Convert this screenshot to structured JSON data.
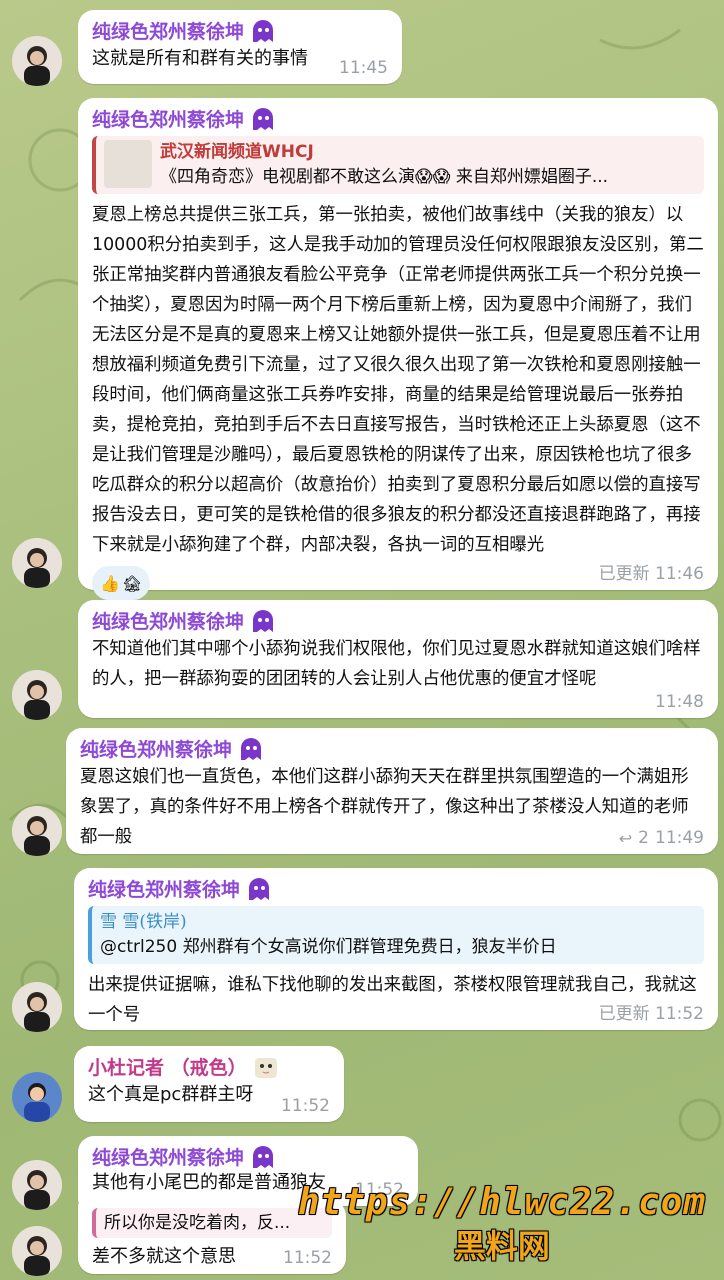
{
  "messages": [
    {
      "sender": "纯绿色郑州蔡徐坤",
      "text": "这就是所有和群有关的事情",
      "time": "11:45"
    },
    {
      "sender": "纯绿色郑州蔡徐坤",
      "reply": {
        "title": "武汉新闻频道WHCJ",
        "text": "《四角奇恋》电视剧都不敢这么演😱😱 来自郑州嫖娼圈子..."
      },
      "text": "夏恩上榜总共提供三张工兵，第一张拍卖，被他们故事线中（关我的狼友）以10000积分拍卖到手，这人是我手动加的管理员没任何权限跟狼友没区别，第二张正常抽奖群内普通狼友看脸公平竞争（正常老师提供两张工兵一个积分兑换一个抽奖），夏恩因为时隔一两个月下榜后重新上榜，因为夏恩中介闹掰了，我们无法区分是不是真的夏恩来上榜又让她额外提供一张工兵，但是夏恩压着不让用想放福利频道免费引下流量，过了又很久很久出现了第一次铁枪和夏恩刚接触一段时间，他们俩商量这张工兵券咋安排，商量的结果是给管理说最后一张券拍卖，提枪竞拍，竞拍到手后不去日直接写报告，当时铁枪还正上头舔夏恩（这不是让我们管理是沙雕吗），最后夏恩铁枪的阴谋传了出来，原因铁枪也坑了很多吃瓜群众的积分以超高价（故意抬价）拍卖到了夏恩积分最后如愿以偿的直接写报告没去日，更可笑的是铁枪借的很多狼友的积分都没还直接退群跑路了，再接下来就是小舔狗建了个群，内部决裂，各执一词的互相曝光",
      "reactions": [
        "👍",
        "🏚"
      ],
      "time": "已更新 11:46"
    },
    {
      "sender": "纯绿色郑州蔡徐坤",
      "text": "不知道他们其中哪个小舔狗说我们权限他，你们见过夏恩水群就知道这娘们啥样的人，把一群舔狗耍的团团转的人会让别人占他优惠的便宜才怪呢",
      "time": "11:48"
    },
    {
      "sender": "纯绿色郑州蔡徐坤",
      "text": "夏恩这娘们也一直货色，本他们这群小舔狗天天在群里拱氛围塑造的一个满姐形象罢了，真的条件好不用上榜各个群就传开了，像这种出了茶楼没人知道的老师都一般",
      "replies_count": "2",
      "time": "11:49"
    },
    {
      "sender": "纯绿色郑州蔡徐坤",
      "reply": {
        "title": "雪 雪(铁岸)",
        "text": "@ctrl250 郑州群有个女高说你们群管理免费日，狼友半价日"
      },
      "text": "出来提供证据嘛，谁私下找他聊的发出来截图，茶楼权限管理就我自己，我就这一个号",
      "time": "已更新 11:52"
    },
    {
      "sender": "小杜记者 （戒色）",
      "text": "这个真是pc群群主呀",
      "time": "11:52"
    },
    {
      "sender": "纯绿色郑州蔡徐坤",
      "text": "其他有小尾巴的都是普通狼友",
      "time": "11:52"
    },
    {
      "reply_text": "所以你是没吃着肉，反...",
      "text": "差不多就这个意思",
      "time": "11:52"
    }
  ],
  "watermark": {
    "line1": "https://hlwc22.com",
    "line2": "黑料网"
  },
  "colors": {
    "name": "#8e4ad6",
    "reply_red": "#c23a3a",
    "reply_blue": "#3a8ec8",
    "meta": "#9aa0a6"
  }
}
